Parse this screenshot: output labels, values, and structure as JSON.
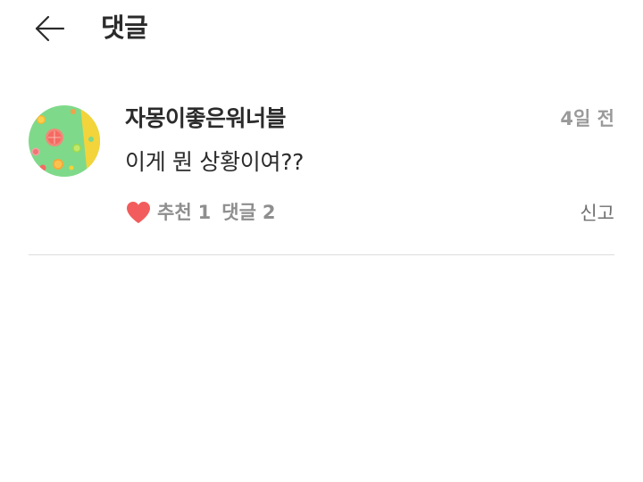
{
  "header": {
    "title": "댓글",
    "back_icon": "arrow-left-icon"
  },
  "comment": {
    "author": "자몽이좋은워너블",
    "timestamp": "4일 전",
    "text": "이게 뭔 상황이여??",
    "like_label": "추천",
    "like_count": "1",
    "reply_label": "댓글",
    "reply_count": "2",
    "report_label": "신고",
    "heart_icon": "heart-icon",
    "heart_color": "#f25c5c",
    "avatar_icon": "citrus-avatar-image"
  },
  "colors": {
    "text_primary": "#2b2b2b",
    "text_secondary": "#9a9a9a",
    "divider": "#dcdcdc",
    "heart": "#f25c5c"
  }
}
